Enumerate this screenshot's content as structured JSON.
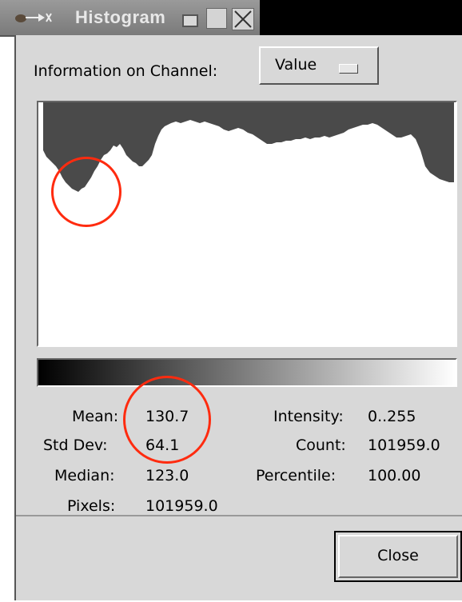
{
  "window": {
    "title": "Histogram"
  },
  "channel": {
    "label": "Information on Channel:",
    "selected": "Value"
  },
  "stats": {
    "mean_label": "Mean:",
    "mean_value": "130.7",
    "stddev_label": "Std Dev:",
    "stddev_value": "64.1",
    "median_label": "Median:",
    "median_value": "123.0",
    "pixels_label": "Pixels:",
    "pixels_value": "101959.0",
    "intensity_label": "Intensity:",
    "intensity_value": "0..255",
    "count_label": "Count:",
    "count_value": "101959.0",
    "percentile_label": "Percentile:",
    "percentile_value": "100.00"
  },
  "buttons": {
    "close_label": "Close"
  },
  "colors": {
    "histogram_fill": "#4a4a4a",
    "annotation": "#ff2b0f"
  },
  "icons": {
    "app": "gimp-icon",
    "minimize": "minimize-icon",
    "maximize": "maximize-icon",
    "close": "close-icon"
  }
}
